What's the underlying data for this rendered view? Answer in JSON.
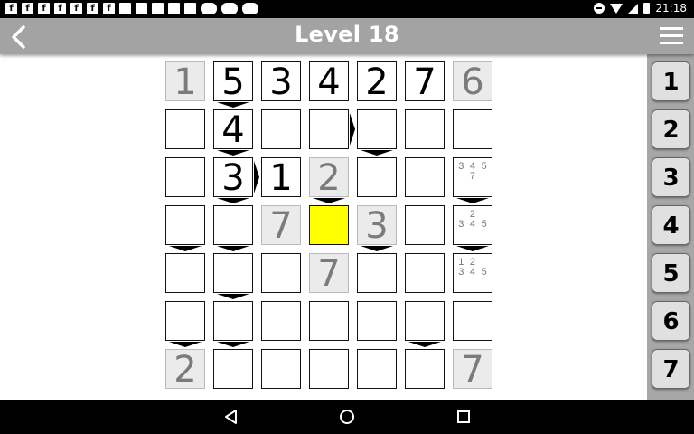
{
  "status_bar": {
    "time": "21:18",
    "notification_icons": [
      "f",
      "f",
      "f",
      "f",
      "f",
      "f",
      "f",
      "image-icon",
      "mail-icon",
      "chat-icon",
      "play-icon",
      "android-icon",
      "youtube-icon",
      "youtube-icon",
      "youtube-icon"
    ]
  },
  "app_bar": {
    "title": "Level 18",
    "back_icon": "chevron-left-icon",
    "menu_icon": "hamburger-menu-icon"
  },
  "board": {
    "size": 7,
    "rows": [
      [
        {
          "v": "1",
          "given": true
        },
        {
          "v": "5"
        },
        {
          "v": "3"
        },
        {
          "v": "4"
        },
        {
          "v": "2"
        },
        {
          "v": "7"
        },
        {
          "v": "6",
          "given": true
        }
      ],
      [
        {
          "v": ""
        },
        {
          "v": "4"
        },
        {
          "v": ""
        },
        {
          "v": ""
        },
        {
          "v": ""
        },
        {
          "v": ""
        },
        {
          "v": ""
        }
      ],
      [
        {
          "v": ""
        },
        {
          "v": "3"
        },
        {
          "v": "1"
        },
        {
          "v": "2",
          "given": true
        },
        {
          "v": ""
        },
        {
          "v": ""
        },
        {
          "cands": [
            "3",
            "4",
            "5",
            "",
            "7",
            ""
          ]
        }
      ],
      [
        {
          "v": ""
        },
        {
          "v": ""
        },
        {
          "v": "7",
          "given": true
        },
        {
          "v": "",
          "selected": true
        },
        {
          "v": "3",
          "given": true
        },
        {
          "v": ""
        },
        {
          "cands": [
            "",
            "2",
            "",
            "3",
            "4",
            "5"
          ]
        }
      ],
      [
        {
          "v": ""
        },
        {
          "v": ""
        },
        {
          "v": ""
        },
        {
          "v": "7",
          "given": true
        },
        {
          "v": ""
        },
        {
          "v": ""
        },
        {
          "cands": [
            "1",
            "2",
            "",
            "3",
            "4",
            "5"
          ]
        }
      ],
      [
        {
          "v": ""
        },
        {
          "v": ""
        },
        {
          "v": ""
        },
        {
          "v": ""
        },
        {
          "v": ""
        },
        {
          "v": ""
        },
        {
          "v": ""
        }
      ],
      [
        {
          "v": "2",
          "given": true
        },
        {
          "v": ""
        },
        {
          "v": ""
        },
        {
          "v": ""
        },
        {
          "v": ""
        },
        {
          "v": ""
        },
        {
          "v": "7",
          "given": true
        }
      ]
    ],
    "down_arrows": [
      [
        0,
        1
      ],
      [
        1,
        1
      ],
      [
        1,
        4
      ],
      [
        2,
        1
      ],
      [
        2,
        3
      ],
      [
        2,
        6
      ],
      [
        3,
        0
      ],
      [
        3,
        1
      ],
      [
        3,
        4
      ],
      [
        3,
        6
      ],
      [
        4,
        1
      ],
      [
        5,
        0
      ],
      [
        5,
        1
      ],
      [
        5,
        5
      ]
    ],
    "right_arrows": [
      [
        1,
        3
      ],
      [
        2,
        1
      ]
    ]
  },
  "number_panel": {
    "buttons": [
      "1",
      "2",
      "3",
      "4",
      "5",
      "6",
      "7"
    ]
  },
  "nav_bar": {
    "back_icon": "triangle-back-icon",
    "home_icon": "circle-home-icon",
    "recents_icon": "square-recents-icon"
  }
}
